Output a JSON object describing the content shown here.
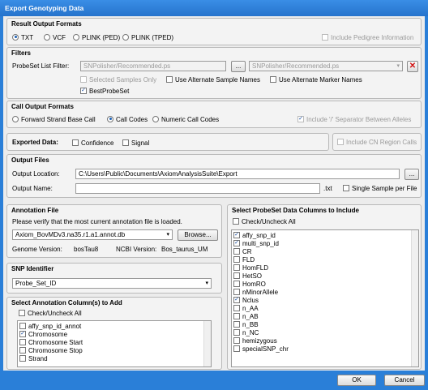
{
  "window": {
    "title": "Export Genotyping Data"
  },
  "result_formats": {
    "title": "Result Output Formats",
    "options": [
      "TXT",
      "VCF",
      "PLINK (PED)",
      "PLINK (TPED)"
    ],
    "selected": "TXT",
    "include_pedigree": "Include Pedigree Information"
  },
  "filters": {
    "title": "Filters",
    "probeset_label": "ProbeSet List Filter:",
    "probeset_value": "SNPolisher/Recommended.ps",
    "browse_label": "...",
    "probeset_select": "SNPolisher/Recommended.ps",
    "selected_samples_only": "Selected Samples Only",
    "alt_sample_names": "Use Alternate Sample Names",
    "alt_marker_names": "Use Alternate Marker Names",
    "best_probeset": "BestProbeSet"
  },
  "call_output": {
    "title": "Call Output Formats",
    "options": [
      "Forward Strand Base Call",
      "Call Codes",
      "Numeric Call Codes"
    ],
    "selected": "Call Codes",
    "include_separator": "Include '/' Separator Between Alleles"
  },
  "exported_data": {
    "label": "Exported Data:",
    "confidence": "Confidence",
    "signal": "Signal",
    "cn_region": "Include CN Region Calls"
  },
  "output_files": {
    "title": "Output Files",
    "location_label": "Output Location:",
    "location_value": "C:\\Users\\Public\\Documents\\AxiomAnalysisSuite\\Export",
    "browse_label": "...",
    "name_label": "Output Name:",
    "name_value": "",
    "ext": ".txt",
    "single_sample": "Single Sample per File"
  },
  "annotation": {
    "title": "Annotation File",
    "notice": "Please verify that the most current annotation file is loaded.",
    "file": "Axiom_BovMDv3.na35.r1.a1.annot.db",
    "browse_label": "Browse...",
    "genome_label": "Genome Version:",
    "genome_value": "bosTau8",
    "ncbi_label": "NCBI Version:",
    "ncbi_value": "Bos_taurus_UM"
  },
  "snp_identifier": {
    "title": "SNP Identifier",
    "value": "Probe_Set_ID"
  },
  "annotation_columns": {
    "title": "Select Annotation Column(s) to Add",
    "check_all": "Check/Uncheck All",
    "items": [
      {
        "label": "affy_snp_id_annot",
        "checked": false
      },
      {
        "label": "Chromosome",
        "checked": true
      },
      {
        "label": "Chromosome Start",
        "checked": false
      },
      {
        "label": "Chromosome Stop",
        "checked": false
      },
      {
        "label": "Strand",
        "checked": false
      }
    ]
  },
  "probeset_columns": {
    "title": "Select ProbeSet Data Columns to Include",
    "check_all": "Check/Uncheck All",
    "items": [
      {
        "label": "affy_snp_id",
        "checked": true
      },
      {
        "label": "multi_snp_id",
        "checked": true
      },
      {
        "label": "CR",
        "checked": false
      },
      {
        "label": "FLD",
        "checked": false
      },
      {
        "label": "HomFLD",
        "checked": false
      },
      {
        "label": "HetSO",
        "checked": false
      },
      {
        "label": "HomRO",
        "checked": false
      },
      {
        "label": "nMinorAllele",
        "checked": false
      },
      {
        "label": "Nclus",
        "checked": true
      },
      {
        "label": "n_AA",
        "checked": false
      },
      {
        "label": "n_AB",
        "checked": false
      },
      {
        "label": "n_BB",
        "checked": false
      },
      {
        "label": "n_NC",
        "checked": false
      },
      {
        "label": "hemizygous",
        "checked": false
      },
      {
        "label": "specialSNP_chr",
        "checked": false
      }
    ]
  },
  "footer": {
    "ok": "OK",
    "cancel": "Cancel"
  },
  "colors": {
    "title_bar": "#2a7fd8",
    "panel": "#ececec",
    "close": "#d01010"
  }
}
